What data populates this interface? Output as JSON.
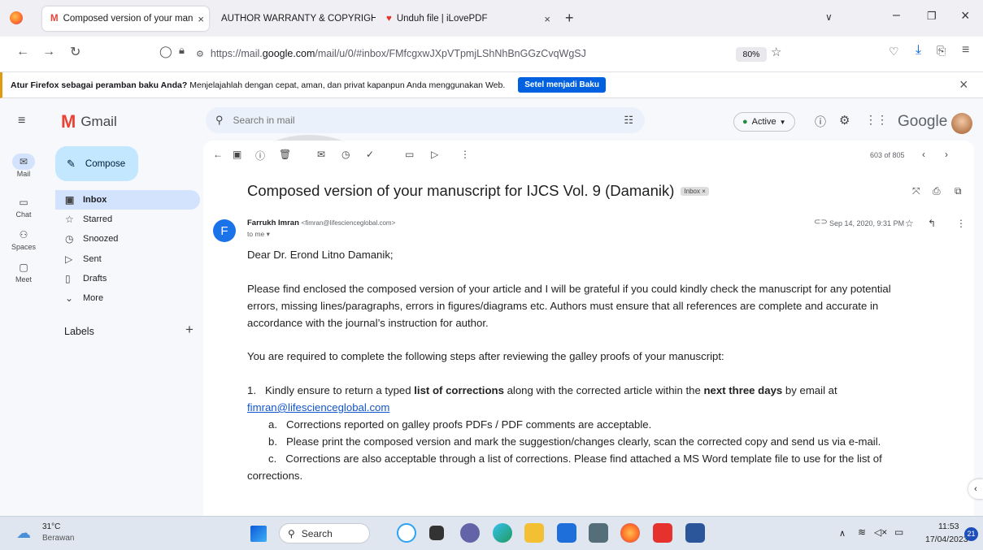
{
  "browser": {
    "tabs": [
      {
        "title": "Composed version of your man",
        "active": true
      },
      {
        "title": "AUTHOR WARRANTY & COPYRIGHT",
        "active": false
      },
      {
        "title": "Unduh file | iLovePDF",
        "active": false
      }
    ],
    "url_prefix": "https://mail.",
    "url_domain": "google.com",
    "url_path": "/mail/u/0/#inbox/FMfcgxwJXpVTpmjLShNhBnGGzCvqWgSJ",
    "zoom": "80%",
    "infobar": {
      "bold": "Atur Firefox sebagai peramban baku Anda?",
      "text": "Menjelajahlah dengan cepat, aman, dan privat kapanpun Anda menggunakan Web.",
      "button": "Setel menjadi Baku"
    }
  },
  "gmail": {
    "app_name": "Gmail",
    "search_placeholder": "Search in mail",
    "status": "Active",
    "brand": "Google",
    "rail": [
      {
        "label": "Mail",
        "icon": "mail-icon"
      },
      {
        "label": "Chat",
        "icon": "chat-icon"
      },
      {
        "label": "Spaces",
        "icon": "spaces-icon"
      },
      {
        "label": "Meet",
        "icon": "meet-icon"
      }
    ],
    "compose_label": "Compose",
    "nav": [
      {
        "label": "Inbox",
        "icon": "inbox-icon"
      },
      {
        "label": "Starred",
        "icon": "star-icon"
      },
      {
        "label": "Snoozed",
        "icon": "clock-icon"
      },
      {
        "label": "Sent",
        "icon": "send-icon"
      },
      {
        "label": "Drafts",
        "icon": "draft-icon"
      },
      {
        "label": "More",
        "icon": "chevron-down-icon"
      }
    ],
    "labels_heading": "Labels",
    "pager": "603 of 805"
  },
  "email": {
    "subject": "Composed version of your manuscript for IJCS Vol. 9 (Damanik)",
    "label_badge": "Inbox ×",
    "sender_name": "Farrukh Imran",
    "sender_email": "<fimran@lifescienceglobal.com>",
    "to": "to me ▾",
    "date": "Sep 14, 2020, 9:31 PM",
    "avatar_letter": "F",
    "greeting": "Dear Dr. Erond Litno Damanik;",
    "para1": [
      "Please find enclosed the composed version of your article and I will be grateful if you could kindly check the manuscript for any potential",
      "errors, missing lines/paragraphs, errors in figures/diagrams etc. Authors must ensure that all references are complete and accurate in",
      "accordance with the journal’s instruction for author."
    ],
    "para2": "You are required to complete the following steps after reviewing the galley proofs of your manuscript:",
    "step1_prefix": "1.   Kindly ensure to return a typed ",
    "step1_bold1": "list of corrections",
    "step1_mid": " along with the corrected article within the ",
    "step1_bold2": "next three days",
    "step1_suffix": " by email at",
    "step1_email": "fimran@lifescienceglobal.com",
    "sub_a": "a.   Corrections reported on galley proofs PDFs / PDF comments are acceptable.",
    "sub_b": "b.   Please print the composed version and mark the suggestion/changes clearly, scan the corrected copy and send us via e-mail.",
    "sub_c1": "c.   Corrections are also acceptable through a list of corrections. Please find attached a MS Word template file to use for the list of",
    "sub_c2": "corrections."
  },
  "taskbar": {
    "temperature": "31°C",
    "weather": "Berawan",
    "search": "Search",
    "time": "11:53",
    "date": "17/04/2023",
    "notif_count": "21"
  },
  "colors": {
    "gmail_bg": "#f6f8fc",
    "compose": "#c2e7ff",
    "active_nav": "#d3e3fd",
    "avatar": "#1a73e8"
  }
}
